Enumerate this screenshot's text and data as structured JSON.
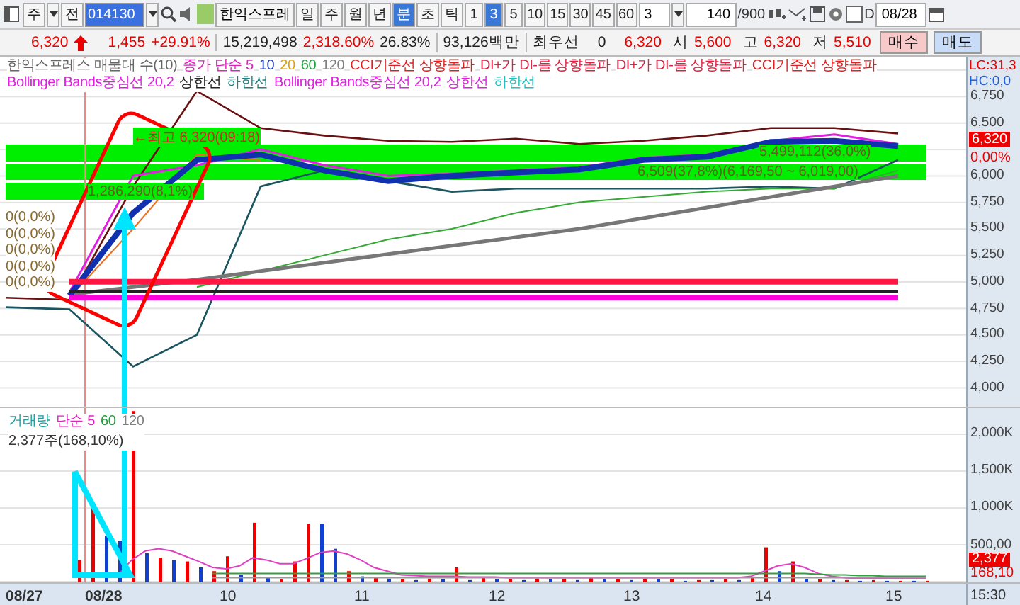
{
  "toolbar": {
    "menu_button": "주",
    "prev_button": "전",
    "code": "014130",
    "stock_name": "한익스프레",
    "period_tabs": [
      {
        "label": "일",
        "selected": false
      },
      {
        "label": "주",
        "selected": false
      },
      {
        "label": "월",
        "selected": false
      },
      {
        "label": "년",
        "selected": false
      },
      {
        "label": "분",
        "selected": true
      },
      {
        "label": "초",
        "selected": false
      },
      {
        "label": "틱",
        "selected": false
      }
    ],
    "interval_buttons": [
      {
        "label": "1",
        "selected": false
      },
      {
        "label": "3",
        "selected": true
      },
      {
        "label": "5",
        "selected": false
      },
      {
        "label": "10",
        "selected": false
      },
      {
        "label": "15",
        "selected": false
      },
      {
        "label": "30",
        "selected": false
      },
      {
        "label": "45",
        "selected": false
      },
      {
        "label": "60",
        "selected": false
      }
    ],
    "interval_value": "3",
    "count": "140",
    "total": "/900",
    "d_checkbox": {
      "label": "D",
      "checked": false
    },
    "date": "08/28"
  },
  "quote": {
    "price": "6,320",
    "change": "1,455",
    "rate": "+29.91%",
    "volume": "15,219,498",
    "volume_rate": "2,318.60%",
    "turnover": "26.83%",
    "amount": "93,126백만",
    "best_label": "최우선",
    "best_value": "0",
    "best_price": "6,320",
    "ohlc": [
      {
        "label": "시",
        "value": "5,600"
      },
      {
        "label": "고",
        "value": "6,320"
      },
      {
        "label": "저",
        "value": "5,510"
      }
    ],
    "buttons": [
      {
        "label": "매수",
        "kind": "buy"
      },
      {
        "label": "매도",
        "kind": "sell"
      }
    ]
  },
  "price_pane": {
    "legend_rows": [
      [
        {
          "text": "한익스프레스 매물대 수(10)",
          "color": "#666666"
        },
        {
          "text": "종가 단순 5",
          "color": "#e020c0"
        },
        {
          "text": "10",
          "color": "#2040d0"
        },
        {
          "text": "20",
          "color": "#e0a000"
        },
        {
          "text": "60",
          "color": "#20a040"
        },
        {
          "text": "120",
          "color": "#808080"
        },
        {
          "text": "CCI기준선 상향돌파",
          "color": "#e02020"
        },
        {
          "text": "DI+가 DI-를 상향돌파",
          "color": "#e02040"
        },
        {
          "text": "DI+가 DI-를 상향돌파",
          "color": "#e02040"
        },
        {
          "text": "CCI기준선 상향돌파",
          "color": "#e02020"
        }
      ],
      [
        {
          "text": "Bollinger Bands중심선 20,2",
          "color": "#e020e0"
        },
        {
          "text": "상한선",
          "color": "#222222"
        },
        {
          "text": "하한선",
          "color": "#208080"
        },
        {
          "text": "Bollinger Bands중심선 20,2",
          "color": "#e020e0"
        },
        {
          "text": "상한선",
          "color": "#e020e0"
        },
        {
          "text": "하한선",
          "color": "#20c0c0"
        }
      ]
    ],
    "corner_lc": "LC:31,3",
    "corner_hc": "HC:0,0",
    "annotations": [
      {
        "text": "←최고 6,320(09:18)",
        "kind": "high"
      },
      {
        "text": "1,286,290(8,1%)",
        "kind": "profile"
      },
      {
        "text": "5,499,112(36,0%)",
        "kind": "profile"
      },
      {
        "text": "6,509(37,8%)(6,169,50 ~ 6,019,00)",
        "kind": "profile"
      }
    ],
    "zero_labels": [
      "0(0,0%)",
      "0(0,0%)",
      "0(0,0%)",
      "0(0,0%)",
      "0(0,0%)"
    ],
    "chart_data": {
      "type": "line",
      "ylim": [
        3822,
        7124
      ],
      "yticks": [
        {
          "value": 6750,
          "label": "6,750"
        },
        {
          "value": 6500,
          "label": "6,500"
        },
        {
          "value": 6000,
          "label": "6,000"
        },
        {
          "value": 5750,
          "label": "5,750"
        },
        {
          "value": 5500,
          "label": "5,500"
        },
        {
          "value": 5250,
          "label": "5,250"
        },
        {
          "value": 5000,
          "label": "5,000"
        },
        {
          "value": 4750,
          "label": "4,750"
        },
        {
          "value": 4500,
          "label": "4,500"
        },
        {
          "value": 4250,
          "label": "4,250"
        },
        {
          "value": 4000,
          "label": "4,000"
        }
      ],
      "series": [
        {
          "color": "#6b1010",
          "values": [
            4850,
            4830,
            5900,
            6800,
            6450,
            6380,
            6330,
            6320,
            6350,
            6300,
            6330,
            6380,
            6450,
            6450,
            6400
          ]
        },
        {
          "color": "#1a5560",
          "values": [
            4760,
            4740,
            4200,
            4500,
            5900,
            6050,
            5950,
            5850,
            5880,
            5880,
            5880,
            5880,
            5900,
            5880,
            6150
          ]
        },
        {
          "color": "#e020e0",
          "values": [
            null,
            4900,
            6000,
            6100,
            6250,
            6100,
            6000,
            6020,
            6050,
            6080,
            6170,
            6200,
            6330,
            6390,
            6300
          ]
        },
        {
          "color": "#e87020",
          "values": [
            null,
            4850,
            5500,
            6200,
            6150,
            null,
            null,
            null,
            null,
            null,
            null,
            null,
            null,
            null,
            null
          ]
        },
        {
          "color": "#33aa33",
          "values": [
            null,
            null,
            null,
            4950,
            5100,
            5250,
            5400,
            5500,
            5650,
            5750,
            5800,
            5850,
            5880,
            5880,
            6050
          ]
        },
        {
          "color": "#777777",
          "values": [
            null,
            4880,
            4950,
            5020,
            5100,
            5180,
            5260,
            5340,
            5420,
            5500,
            5600,
            5700,
            5800,
            5900,
            6000
          ]
        },
        {
          "color": "#1030b0",
          "values": [
            null,
            4870,
            5650,
            6150,
            6200,
            6050,
            5950,
            6000,
            6030,
            6060,
            6150,
            6180,
            6320,
            6330,
            6280
          ]
        },
        {
          "color": "#ff1744",
          "values": [
            null,
            5000,
            5000,
            5000,
            5000,
            5000,
            5000,
            5000,
            5000,
            5000,
            5000,
            5000,
            5000,
            5000,
            5000
          ]
        },
        {
          "color": "#222222",
          "values": [
            null,
            4910,
            4910,
            4910,
            4910,
            4910,
            4910,
            4910,
            4910,
            4910,
            4910,
            4910,
            4910,
            4910,
            4910
          ]
        },
        {
          "color": "#ff00dd",
          "values": [
            null,
            4850,
            4850,
            4850,
            4850,
            4850,
            4850,
            4850,
            4850,
            4850,
            4850,
            4850,
            4850,
            4850,
            4850
          ]
        }
      ]
    },
    "current_price": "6,320",
    "current_rate": "0,00%"
  },
  "volume_pane": {
    "legend": [
      {
        "text": "거래량",
        "color": "#20a0a0"
      },
      {
        "text": "단순 5",
        "color": "#e020c0"
      },
      {
        "text": "60",
        "color": "#20a040"
      },
      {
        "text": "120",
        "color": "#808080"
      }
    ],
    "volume_label": "2,377주(168,10%)",
    "chart_data": {
      "type": "bar",
      "ylim": [
        0,
        2340
      ],
      "yticks": [
        {
          "value": 2000,
          "label": "2,000K"
        },
        {
          "value": 1500,
          "label": "1,500K"
        },
        {
          "value": 1000,
          "label": "1,000K"
        },
        {
          "value": 500,
          "label": "500,00"
        }
      ],
      "series": [
        {
          "color": "#ee0000",
          "values": [
            300,
            1000,
            null,
            null,
            2300,
            null,
            330,
            null,
            280,
            null,
            150,
            350,
            null,
            800,
            null,
            40,
            280,
            780,
            null,
            null,
            150,
            null,
            60,
            null,
            40,
            null,
            50,
            null,
            200,
            null,
            60,
            null,
            40,
            null,
            50,
            null,
            40,
            null,
            60,
            null,
            40,
            null,
            50,
            null,
            40,
            null,
            30,
            null,
            40,
            null,
            60,
            470,
            null,
            280,
            null,
            40,
            null,
            30,
            null,
            30,
            null,
            20,
            null,
            20
          ]
        },
        {
          "color": "#1040d0",
          "values": [
            null,
            null,
            620,
            560,
            null,
            390,
            null,
            300,
            null,
            200,
            null,
            null,
            100,
            null,
            60,
            null,
            null,
            null,
            780,
            450,
            null,
            80,
            null,
            50,
            null,
            30,
            null,
            40,
            null,
            30,
            null,
            40,
            null,
            30,
            null,
            40,
            null,
            30,
            null,
            40,
            null,
            30,
            null,
            40,
            null,
            20,
            null,
            30,
            null,
            30,
            null,
            null,
            150,
            null,
            40,
            null,
            30,
            null,
            20,
            null,
            20,
            null,
            20,
            null
          ]
        },
        {
          "type": "line",
          "color": "#e040c0",
          "values": [
            null,
            null,
            null,
            100,
            300,
            420,
            450,
            420,
            350,
            280,
            200,
            180,
            220,
            330,
            300,
            250,
            250,
            320,
            400,
            420,
            380,
            300,
            200,
            150,
            100,
            90,
            80,
            80,
            80,
            70,
            70,
            70,
            60,
            60,
            60,
            60,
            60,
            60,
            60,
            60,
            60,
            60,
            60,
            60,
            60,
            60,
            60,
            60,
            60,
            60,
            80,
            150,
            220,
            250,
            200,
            120,
            80,
            60,
            50,
            50,
            50,
            50,
            50,
            50
          ]
        },
        {
          "type": "line",
          "color": "#30a040",
          "values": [
            null,
            null,
            null,
            null,
            null,
            null,
            null,
            null,
            null,
            null,
            120,
            120,
            120,
            120,
            120,
            120,
            120,
            120,
            120,
            120,
            120,
            120,
            120,
            120,
            120,
            120,
            120,
            120,
            120,
            120,
            120,
            120,
            120,
            120,
            120,
            120,
            120,
            120,
            120,
            120,
            120,
            120,
            120,
            120,
            120,
            120,
            120,
            120,
            120,
            120,
            120,
            120,
            120,
            120,
            120,
            110,
            100,
            100,
            90,
            90,
            80,
            80,
            80,
            80
          ]
        },
        {
          "type": "line",
          "color": "#999999",
          "values": [
            null,
            null,
            null,
            null,
            null,
            null,
            null,
            null,
            null,
            null,
            60,
            60,
            60,
            60,
            60,
            60,
            60,
            60,
            60,
            60,
            60,
            60,
            60,
            60,
            60,
            60,
            60,
            60,
            60,
            60,
            60,
            60,
            60,
            60,
            60,
            60,
            60,
            60,
            60,
            60,
            60,
            60,
            60,
            60,
            60,
            60,
            60,
            60,
            60,
            60,
            60,
            60,
            60,
            60,
            60,
            60,
            60,
            60,
            60,
            60,
            60,
            60,
            60,
            60
          ]
        }
      ]
    },
    "current_volume": "2,377",
    "current_rate": "168,10"
  },
  "x_axis": [
    "08/27",
    "08/28",
    "10",
    "11",
    "12",
    "13",
    "14",
    "15"
  ],
  "time_label": "15:30"
}
